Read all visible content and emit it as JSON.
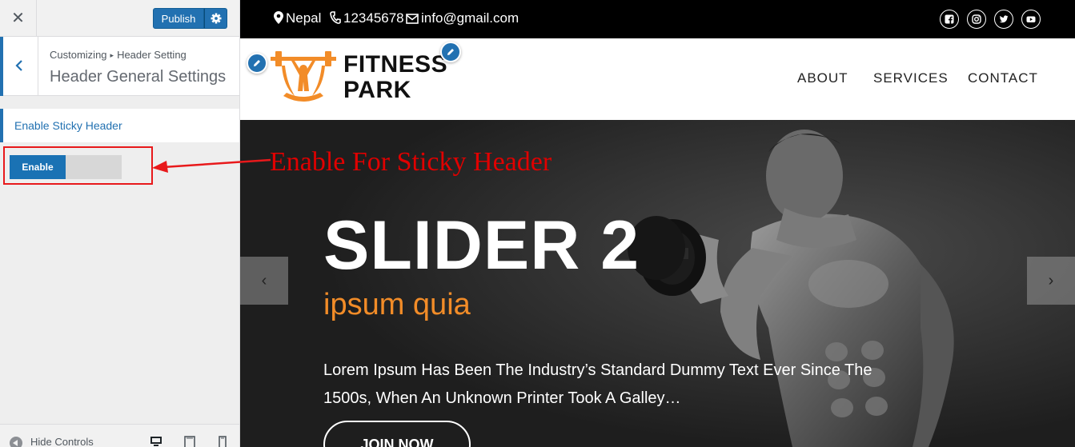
{
  "customizer": {
    "close_icon": "close-icon",
    "publish_label": "Publish",
    "settings_icon": "gear-icon",
    "breadcrumb_root": "Customizing",
    "breadcrumb_section": "Header Setting",
    "section_title": "Header General Settings",
    "control_label": "Enable Sticky Header",
    "toggle_label": "Enable",
    "toggle_state": "enabled",
    "hide_controls": "Hide Controls",
    "accent_color": "#2271b1"
  },
  "annotation": {
    "text": "Enable For Sticky Header",
    "color": "#e00000"
  },
  "site": {
    "topbar": {
      "location": "Nepal",
      "phone": "12345678",
      "email": "info@gmail.com",
      "social_icons": [
        "facebook-icon",
        "instagram-icon",
        "twitter-icon",
        "youtube-icon"
      ]
    },
    "logo_line1": "FITNESS",
    "logo_line2": "PARK",
    "logo_color": "#f28c28",
    "nav": [
      "ABOUT",
      "SERVICES",
      "CONTACT"
    ],
    "slider": {
      "title": "SLIDER 2",
      "subtitle": "ipsum quia",
      "description": "Lorem Ipsum Has Been The Industry’s Standard Dummy Text Ever Since The 1500s, When An Unknown Printer Took A Galley…",
      "button": "JOIN NOW",
      "prev": "‹",
      "next": "›"
    }
  }
}
